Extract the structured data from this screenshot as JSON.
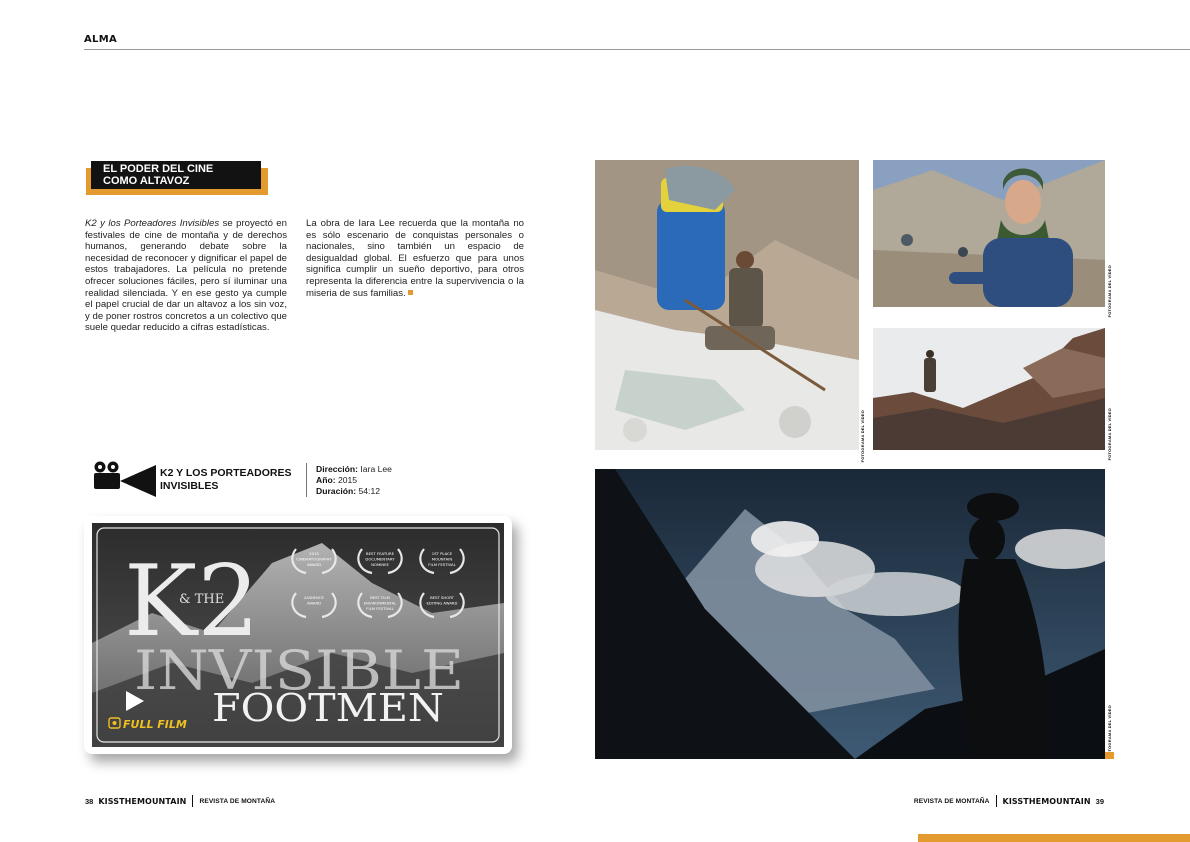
{
  "header": {
    "section": "ALMA"
  },
  "article": {
    "title_line1": "EL PODER DEL CINE",
    "title_line2": "COMO ALTAVOZ",
    "col1_italic": "K2 y los Porteadores Invisibles",
    "col1_text": " se proyectó en festivales de cine de montaña y de derechos humanos, generando debate sobre la necesidad de reconocer y dignificar el papel de estos trabajadores. La película no pretende ofrecer soluciones fáciles, pero sí iluminar una realidad silenciada. Y en ese gesto ya cumple el papel crucial de dar un altavoz a los sin voz, y de poner rostros concretos a un colectivo que suele quedar reducido a cifras estadísticas.",
    "col2_text": "La obra de Iara Lee recuerda que la montaña no es sólo escenario de conquistas personales o nacionales, sino también un espacio de desigualdad global. El esfuerzo que para unos significa cumplir un sueño deportivo, para otros representa la diferencia entre la supervivencia o la miseria de sus familias."
  },
  "film": {
    "title_line1": "K2 Y LOS PORTEADORES",
    "title_line2": "INVISIBLES",
    "direction_label": "Dirección:",
    "direction_value": " Iara Lee",
    "year_label": "Año:",
    "year_value": " 2015",
    "duration_label": "Duración:",
    "duration_value": " 54:12"
  },
  "video": {
    "poster_k2": "K2",
    "poster_and_the": "& THE",
    "poster_invisible": "INVISIBLE",
    "poster_footmen": "FOOTMEN",
    "full_film_label": "FULL FILM",
    "laurels": [
      {
        "line1": "2015",
        "line2": "CINEMATOGRAPHY",
        "line3": "AWARD"
      },
      {
        "line1": "BEST FEATURE",
        "line2": "DOCUMENTARY",
        "line3": "NOMINEE"
      },
      {
        "line1": "1ST PLACE",
        "line2": "MOUNTAIN",
        "line3": "FILM FESTIVAL"
      },
      {
        "line1": "AUDIENCE",
        "line2": "AWARD",
        "line3": ""
      },
      {
        "line1": "BEST FILM",
        "line2": "ENVIRONMENTAL",
        "line3": "FILM FESTIVAL"
      },
      {
        "line1": "BEST SHORT",
        "line2": "EDITING AWARD",
        "line3": ""
      }
    ]
  },
  "photo_credits": {
    "credit_1": "FOTOGRAMA DEL VÍDEO",
    "credit_2": "FOTOGRAMA DEL VÍDEO",
    "credit_3": "FOTOGRAMA DEL VÍDEO",
    "credit_4": "FOTOGRAMA DEL VÍDEO"
  },
  "footer": {
    "left_page": "38",
    "left_brand": "KISSTHEMOUNTAIN",
    "left_mag": "REVISTA DE MONTAÑA",
    "right_mag": "REVISTA DE MONTAÑA",
    "right_brand": "KISSTHEMOUNTAIN",
    "right_page": "39"
  },
  "colors": {
    "accent": "#e39a2e",
    "title_bg": "#121212",
    "rule": "#9a9a9a"
  },
  "icons": {
    "camera": "movie-camera-icon",
    "play": "play-icon",
    "film_logo": "film-logo-icon",
    "laurel": "laurel-icon"
  }
}
